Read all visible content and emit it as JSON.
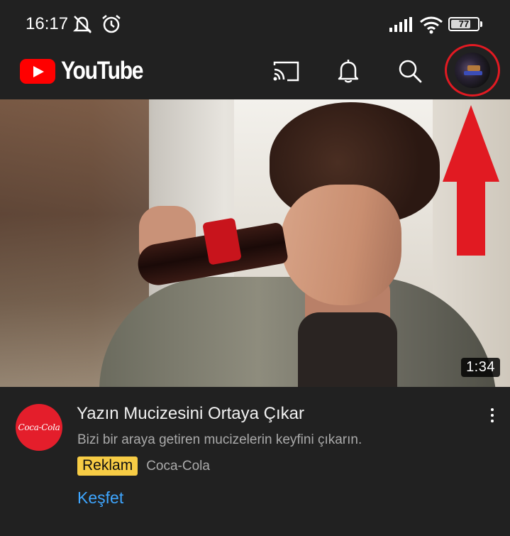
{
  "status_bar": {
    "time": "16:17",
    "battery": "77",
    "battery_level": 0.77,
    "icons": [
      "mute-icon",
      "alarm-icon",
      "signal-icon",
      "wifi-icon",
      "battery-icon"
    ]
  },
  "app_bar": {
    "logo_text": "YouTube",
    "icons": [
      "cast-icon",
      "bell-icon",
      "search-icon",
      "avatar"
    ]
  },
  "video": {
    "duration": "1:34"
  },
  "ad": {
    "channel_logo_text": "Coca-Cola",
    "title": "Yazın Mucizesini Ortaya Çıkar",
    "description": "Bizi bir araya getiren mucizelerin keyfini çıkarın.",
    "badge": "Reklam",
    "advertiser": "Coca-Cola",
    "cta": "Keşfet"
  },
  "colors": {
    "background": "#212121",
    "youtube_red": "#ff0000",
    "ad_badge": "#f7cc45",
    "link_blue": "#3ea6ff",
    "annotation_red": "#e11a22"
  }
}
